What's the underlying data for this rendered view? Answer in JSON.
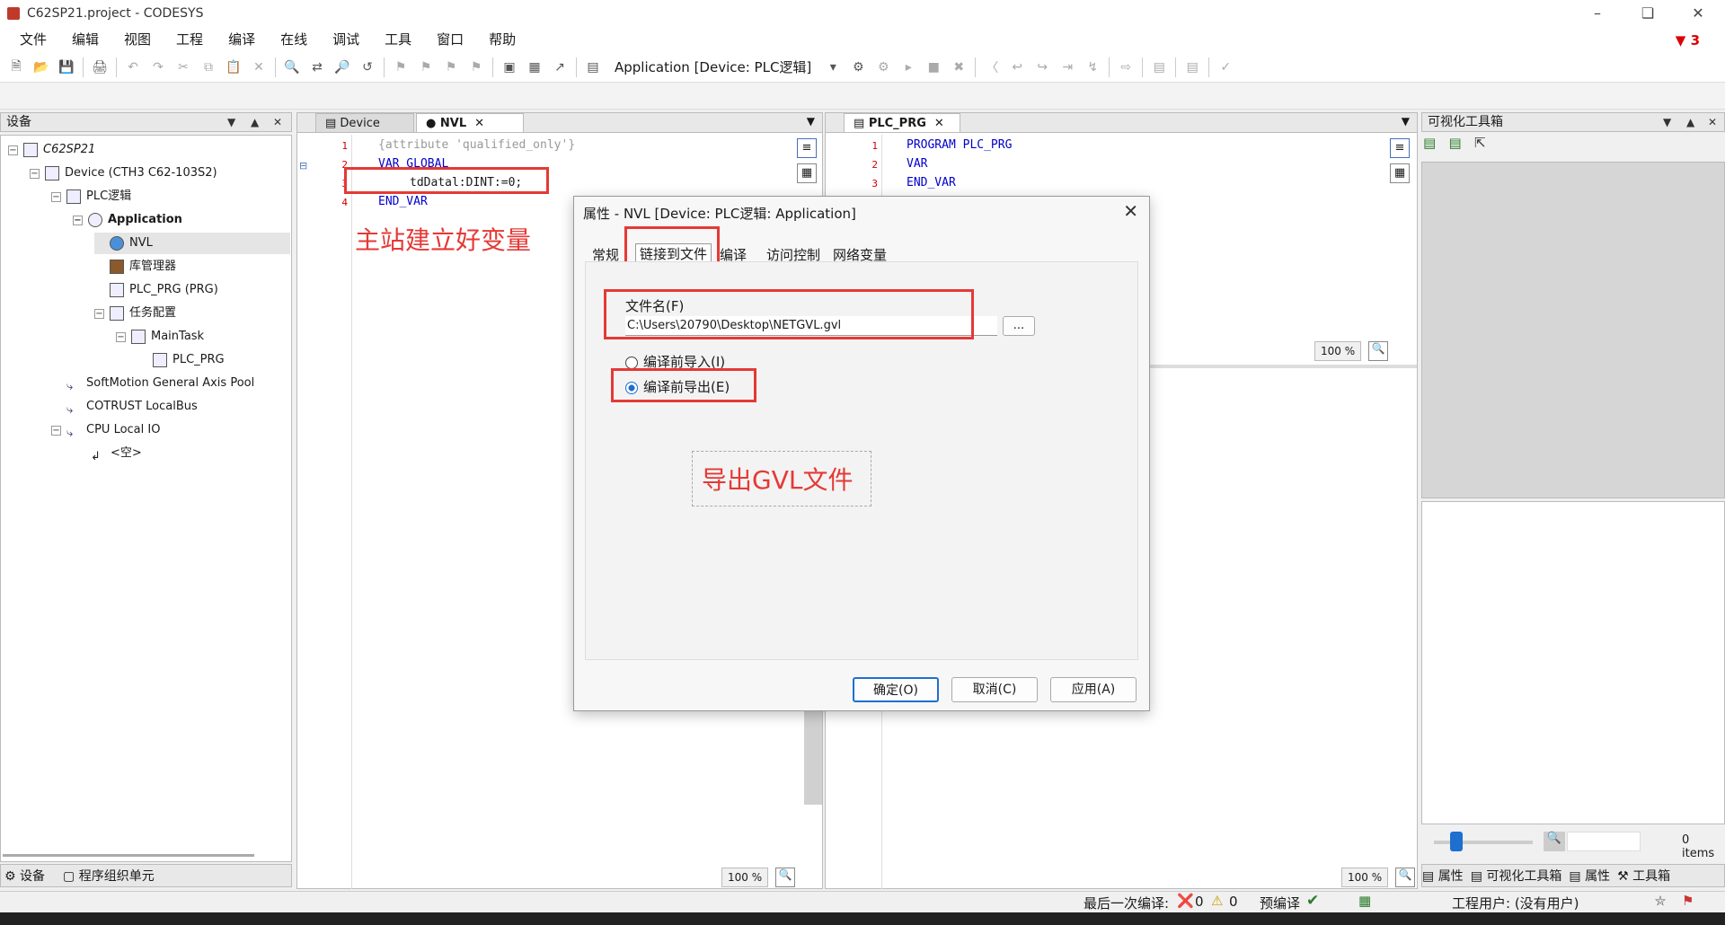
{
  "window": {
    "title": "C62SP21.project - CODESYS",
    "notification_count": "3"
  },
  "menu": [
    "文件",
    "编辑",
    "视图",
    "工程",
    "编译",
    "在线",
    "调试",
    "工具",
    "窗口",
    "帮助"
  ],
  "toolbar": {
    "application_selector": "Application [Device: PLC逻辑]"
  },
  "devices_panel": {
    "title": "设备",
    "tree": [
      {
        "label": "C62SP21"
      },
      {
        "label": "Device (CTH3 C62-103S2)"
      },
      {
        "label": "PLC逻辑"
      },
      {
        "label": "Application"
      },
      {
        "label": "NVL"
      },
      {
        "label": "库管理器"
      },
      {
        "label": "PLC_PRG (PRG)"
      },
      {
        "label": "任务配置"
      },
      {
        "label": "MainTask"
      },
      {
        "label": "PLC_PRG"
      },
      {
        "label": "SoftMotion General Axis Pool"
      },
      {
        "label": "COTRUST LocalBus"
      },
      {
        "label": "CPU Local IO"
      },
      {
        "label": "<空>"
      }
    ],
    "bottom_tabs": [
      "设备",
      "程序组织单元"
    ]
  },
  "editor_left": {
    "tabs": [
      "Device",
      "NVL"
    ],
    "lines": [
      {
        "n": "1",
        "text": "{attribute 'qualified_only'}"
      },
      {
        "n": "2",
        "text": "VAR_GLOBAL"
      },
      {
        "n": "3",
        "text": "tdDatal:DINT:=0;"
      },
      {
        "n": "4",
        "text": "END_VAR"
      }
    ],
    "annotation": "主站建立好变量",
    "zoom": "100 %"
  },
  "editor_right": {
    "tab": "PLC_PRG",
    "lines": [
      {
        "n": "1",
        "text": "PROGRAM PLC_PRG"
      },
      {
        "n": "2",
        "text": "VAR"
      },
      {
        "n": "3",
        "text": "END_VAR"
      }
    ],
    "zoom_top": "100 %",
    "zoom_bottom": "100 %"
  },
  "dialog": {
    "title": "属性 - NVL [Device: PLC逻辑: Application]",
    "tabs": [
      "常规",
      "链接到文件",
      "编译",
      "访问控制",
      "网络变量"
    ],
    "file_label": "文件名(F)",
    "file_value": "C:\\Users\\20790\\Desktop\\NETGVL.gvl",
    "browse_label": "...",
    "radio_import": "编译前导入(I)",
    "radio_export": "编译前导出(E)",
    "annotation": "导出GVL文件",
    "buttons": {
      "ok": "确定(O)",
      "cancel": "取消(C)",
      "apply": "应用(A)"
    }
  },
  "right_panel": {
    "title": "可视化工具箱",
    "items_count": "0 items",
    "bottom_tabs": [
      "属性",
      "可视化工具箱",
      "属性",
      "工具箱"
    ]
  },
  "status": {
    "last_compile": "最后一次编译:",
    "errors": "0",
    "warnings": "0",
    "precompile": "预编译",
    "project_user": "工程用户: (没有用户)"
  }
}
